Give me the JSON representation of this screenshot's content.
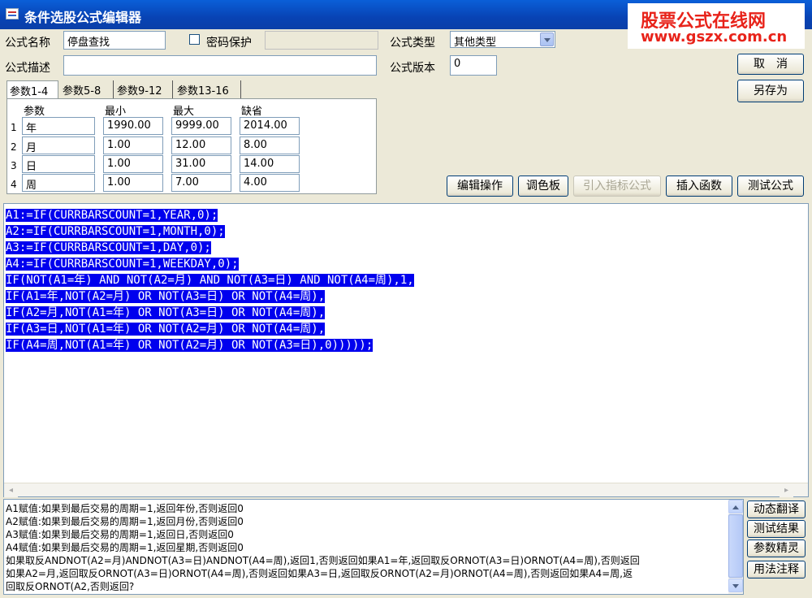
{
  "window": {
    "title": "条件选股公式编辑器"
  },
  "watermark": {
    "line1": "股票公式在线网",
    "line2": "www.gszx.com.cn"
  },
  "form": {
    "name_label": "公式名称",
    "name_value": "停盘查找",
    "password_label": "密码保护",
    "password_checked": false,
    "type_label": "公式类型",
    "type_value": "其他类型",
    "desc_label": "公式描述",
    "desc_value": "",
    "version_label": "公式版本",
    "version_value": "0"
  },
  "buttons": {
    "cancel": "取　消",
    "save_as": "另存为",
    "edit_ops": "编辑操作",
    "palette": "调色板",
    "import": "引入指标公式",
    "insert_func": "插入函数",
    "test_formula": "测试公式",
    "dyn_translate": "动态翻译",
    "test_result": "测试结果",
    "param_wizard": "参数精灵",
    "usage_notes": "用法注释"
  },
  "tabs": [
    "参数1-4",
    "参数5-8",
    "参数9-12",
    "参数13-16"
  ],
  "param_headers": {
    "name": "参数",
    "min": "最小",
    "max": "最大",
    "default": "缺省"
  },
  "params": [
    {
      "num": "1",
      "name": "年",
      "min": "1990.00",
      "max": "9999.00",
      "default": "2014.00"
    },
    {
      "num": "2",
      "name": "月",
      "min": "1.00",
      "max": "12.00",
      "default": "8.00"
    },
    {
      "num": "3",
      "name": "日",
      "min": "1.00",
      "max": "31.00",
      "default": "14.00"
    },
    {
      "num": "4",
      "name": "周",
      "min": "1.00",
      "max": "7.00",
      "default": "4.00"
    }
  ],
  "code_lines": [
    "A1:=IF(CURRBARSCOUNT=1,YEAR,0);",
    "A2:=IF(CURRBARSCOUNT=1,MONTH,0);",
    "A3:=IF(CURRBARSCOUNT=1,DAY,0);",
    "A4:=IF(CURRBARSCOUNT=1,WEEKDAY,0);",
    "IF(NOT(A1=年) AND NOT(A2=月) AND NOT(A3=日) AND NOT(A4=周),1,",
    "IF(A1=年,NOT(A2=月) OR NOT(A3=日) OR NOT(A4=周),",
    "IF(A2=月,NOT(A1=年) OR NOT(A3=日) OR NOT(A4=周),",
    "IF(A3=日,NOT(A1=年) OR NOT(A2=月) OR NOT(A4=周),",
    "IF(A4=周,NOT(A1=年) OR NOT(A2=月) OR NOT(A3=日),0)))));"
  ],
  "translation_lines": [
    "A1赋值:如果到最后交易的周期=1,返回年份,否则返回0",
    "A2赋值:如果到最后交易的周期=1,返回月份,否则返回0",
    "A3赋值:如果到最后交易的周期=1,返回日,否则返回0",
    "A4赋值:如果到最后交易的周期=1,返回星期,否则返回0",
    "如果取反ANDNOT(A2=月)ANDNOT(A3=日)ANDNOT(A4=周),返回1,否则返回如果A1=年,返回取反ORNOT(A3=日)ORNOT(A4=周),否则返回",
    "如果A2=月,返回取反ORNOT(A3=日)ORNOT(A4=周),否则返回如果A3=日,返回取反ORNOT(A2=月)ORNOT(A4=周),否则返回如果A4=周,返",
    "回取反ORNOT(A2,否则返回?"
  ]
}
